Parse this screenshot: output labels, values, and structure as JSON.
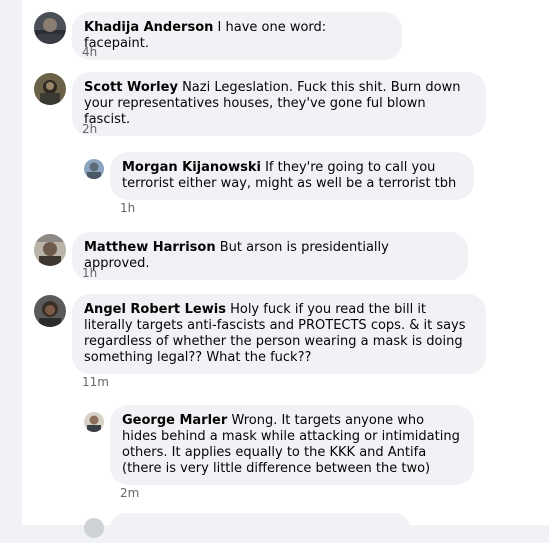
{
  "comments": [
    {
      "author": "Khadija Anderson",
      "text": "I have one word: facepaint.",
      "time": "4h"
    },
    {
      "author": "Scott Worley",
      "text": "Nazi Legeslation. Fuck this shit. Burn down your representatives houses, they've gone ful blown fascist.",
      "time": "2h"
    },
    {
      "author": "Morgan Kijanowski",
      "text": "If they're going to call you terrorist either way, might as well be a terrorist tbh",
      "time": "1h"
    },
    {
      "author": "Matthew Harrison",
      "text": "But arson is presidentially approved.",
      "time": "1h"
    },
    {
      "author": "Angel Robert Lewis",
      "text": "Holy fuck if you read the bill it literally targets anti-fascists and PROTECTS cops. & it says regardless of whether the person wearing a mask is doing something legal?? What the fuck??",
      "time": "11m"
    },
    {
      "author": "George Marler",
      "text": "Wrong. It targets anyone who hides behind a mask while attacking or intimidating others. It applies equally to the KKK and Antifa (there is very little difference between the two)",
      "time": "2m"
    }
  ]
}
